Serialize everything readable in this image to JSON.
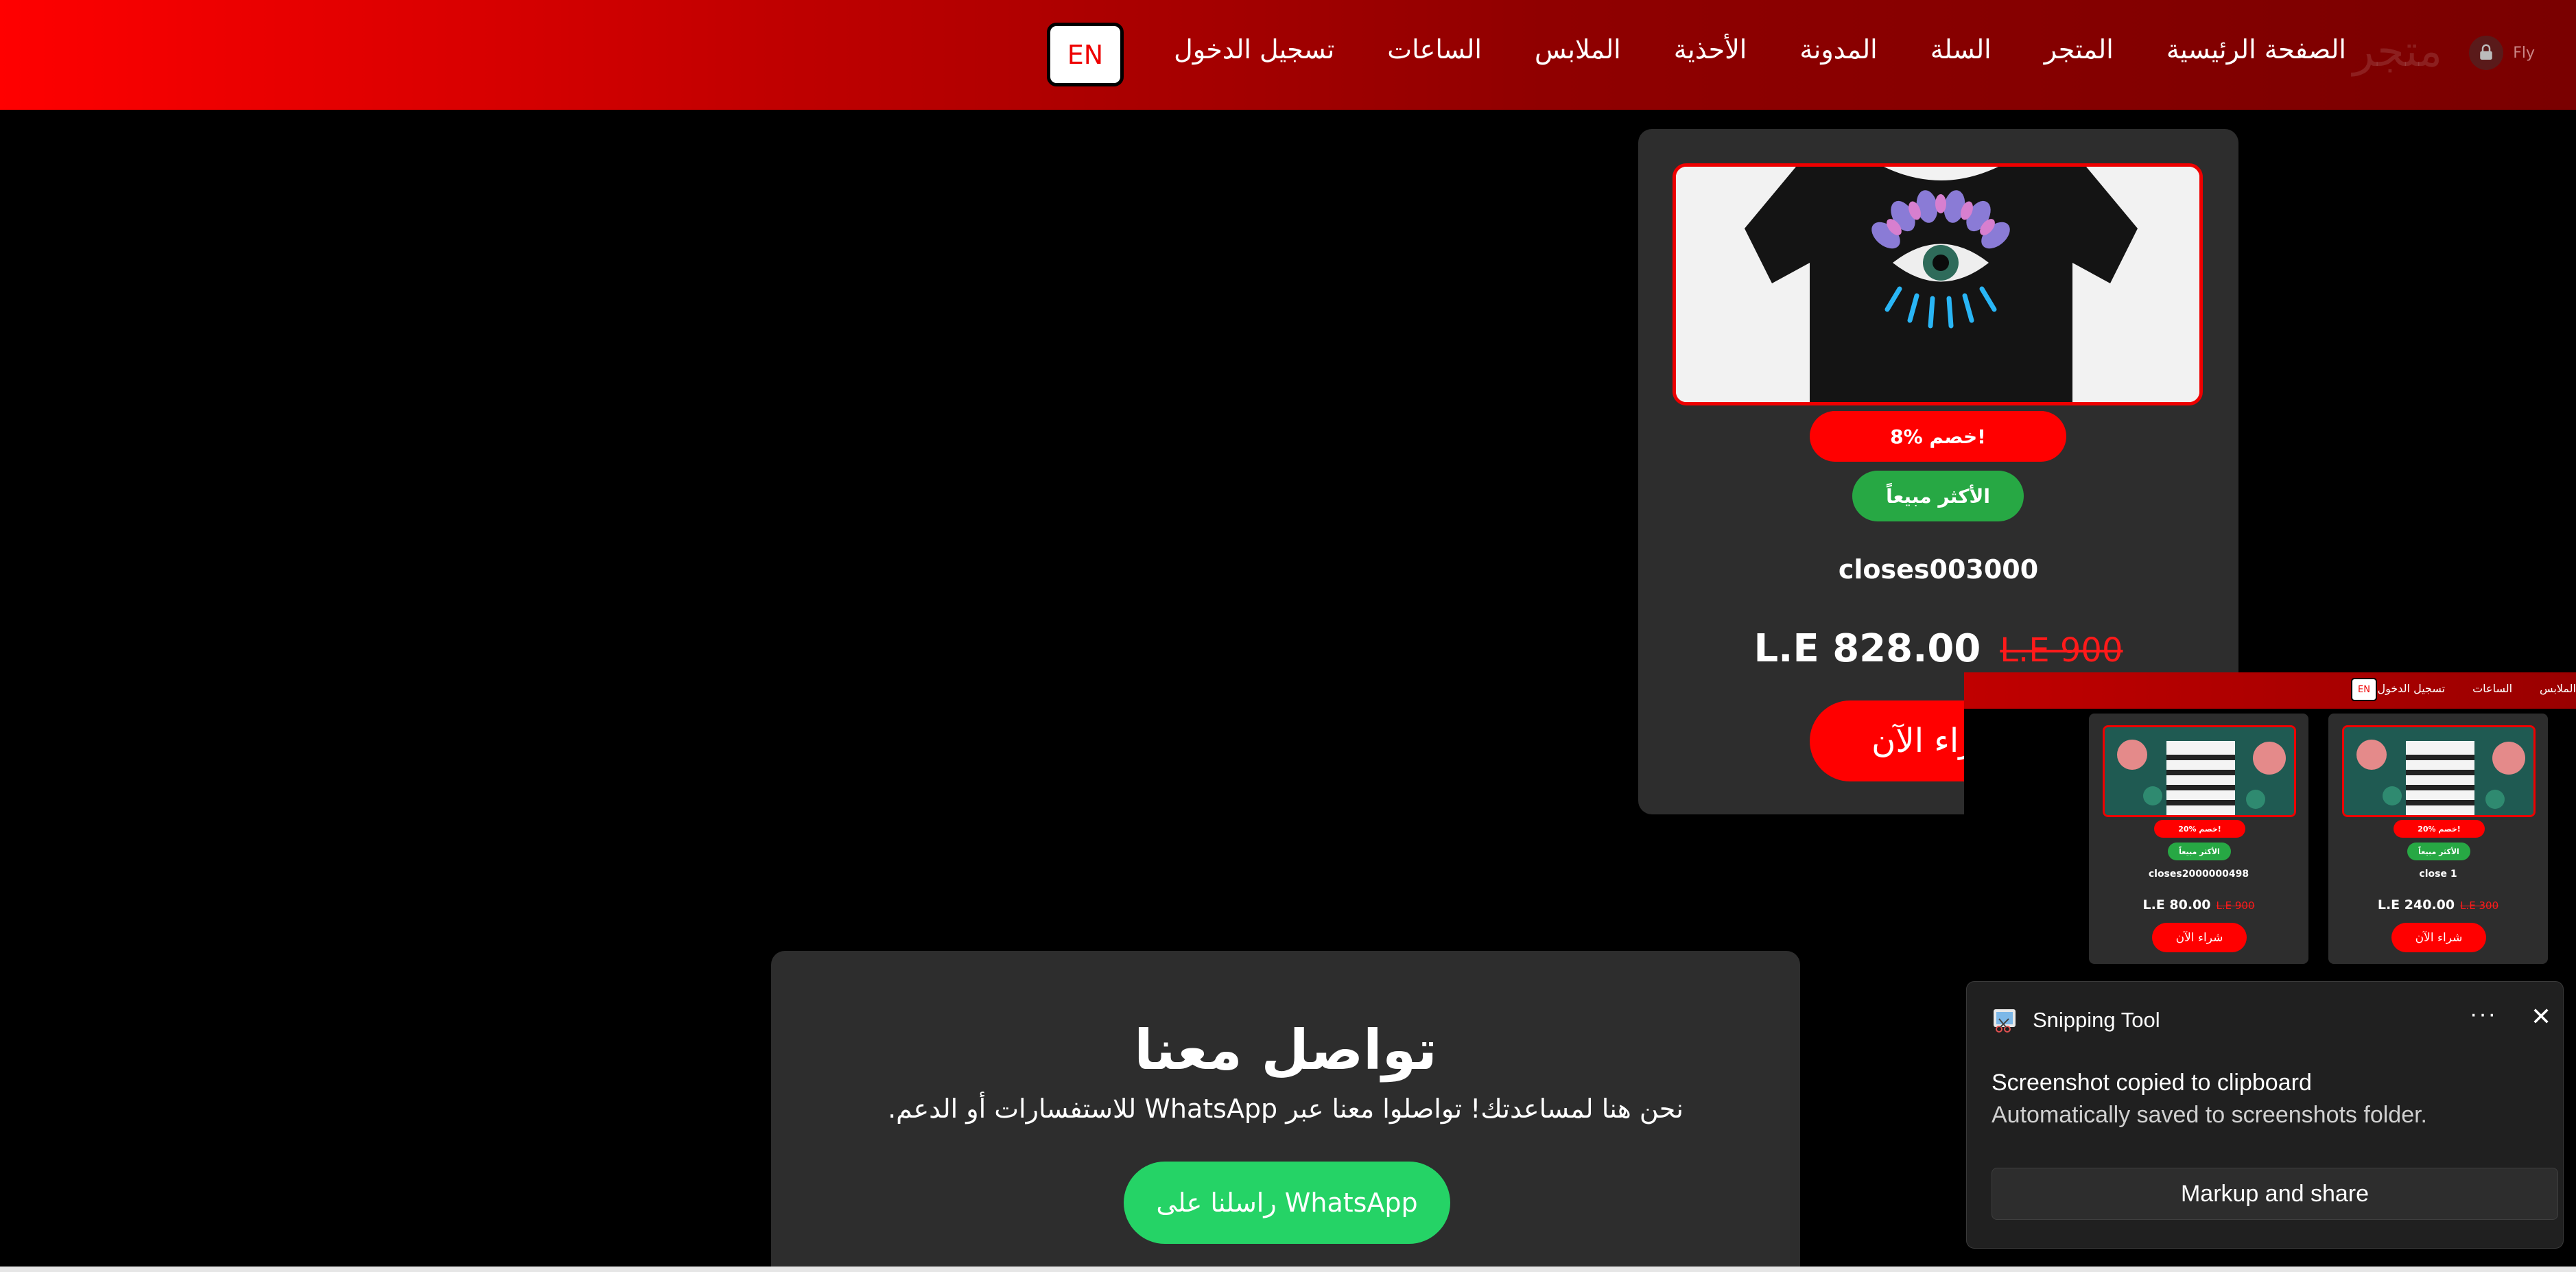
{
  "nav": {
    "brand_text": "Fly",
    "brand_ghost": "متجر",
    "links": [
      "الصفحة الرئيسية",
      "المتجر",
      "السلة",
      "المدونة",
      "الأحذية",
      "الملابس",
      "الساعات",
      "تسجيل الدخول"
    ],
    "lang": "EN"
  },
  "product": {
    "discount_badge": "8% خصم!",
    "best_seller": "الأكثر مبيعاً",
    "name": "closes003000",
    "price_now": "L.E 828.00",
    "price_old": "L.E 900",
    "buy_label": "شراء الآن"
  },
  "contact": {
    "title": "تواصل معنا",
    "description": "نحن هنا لمساعدتك! تواصلوا معنا عبر WhatsApp للاستفسارات أو الدعم.",
    "button": "راسلنا على WhatsApp"
  },
  "thumbnail": {
    "nav_links": [
      "الملابس",
      "الساعات",
      "تسجيل الدخول"
    ],
    "lang": "EN",
    "cards": [
      {
        "discount": "20% خصم!",
        "best": "الأكثر مبيعاً",
        "name": "closes2000000498",
        "price_now": "L.E 80.00",
        "price_old": "L.E 900",
        "buy": "شراء الآن"
      },
      {
        "discount": "20% خصم!",
        "best": "الأكثر مبيعاً",
        "name": "close 1",
        "price_now": "L.E 240.00",
        "price_old": "L.E 300",
        "buy": "شراء الآن"
      }
    ]
  },
  "toast": {
    "app_name": "Snipping Tool",
    "more": "···",
    "close": "✕",
    "title": "Screenshot copied to clipboard",
    "subtitle": "Automatically saved to screenshots folder.",
    "action": "Markup and share"
  },
  "colors": {
    "accent_red": "#ff0000",
    "best_seller_green": "#27a844",
    "whatsapp_green": "#25d366",
    "card_bg": "#2d2d2d"
  }
}
